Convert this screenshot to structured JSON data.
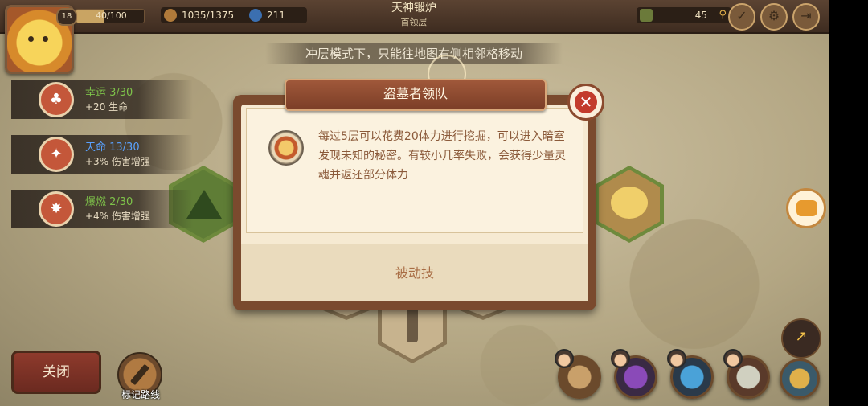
{
  "header": {
    "level": "18",
    "xp_text": "40/100",
    "xp_fraction": 0.4,
    "stamina": "1035/1375",
    "gems": "211",
    "title": "天神锻炉",
    "subtitle": "首领层",
    "bag_count": "45"
  },
  "notice": "冲层模式下，只能往地图右侧相邻格移动",
  "buffs": [
    {
      "name": "幸运 3/30",
      "effect": "+20 生命",
      "color": "#7ec24a",
      "icon": "clover-icon"
    },
    {
      "name": "天命 13/30",
      "effect": "+3% 伤害增强",
      "color": "#5aa2ff",
      "icon": "fate-icon"
    },
    {
      "name": "爆燃 2/30",
      "effect": "+4% 伤害增强",
      "color": "#7ec24a",
      "icon": "explosion-icon"
    }
  ],
  "dialog": {
    "title": "盗墓者领队",
    "description": "每过5层可以花费20体力进行挖掘，可以进入暗室发现未知的秘密。有较小几率失败，会获得少量灵魂并返还部分体力",
    "footer": "被动技",
    "close_glyph": "✕"
  },
  "bottom": {
    "close_label": "关闭",
    "mark_route_label": "标记路线"
  },
  "colors": {
    "dialog_frame": "#7a4a2e",
    "dialog_bg": "#f6ead2",
    "text_brown": "#8b5a3a",
    "close_red": "#c33b2c"
  }
}
